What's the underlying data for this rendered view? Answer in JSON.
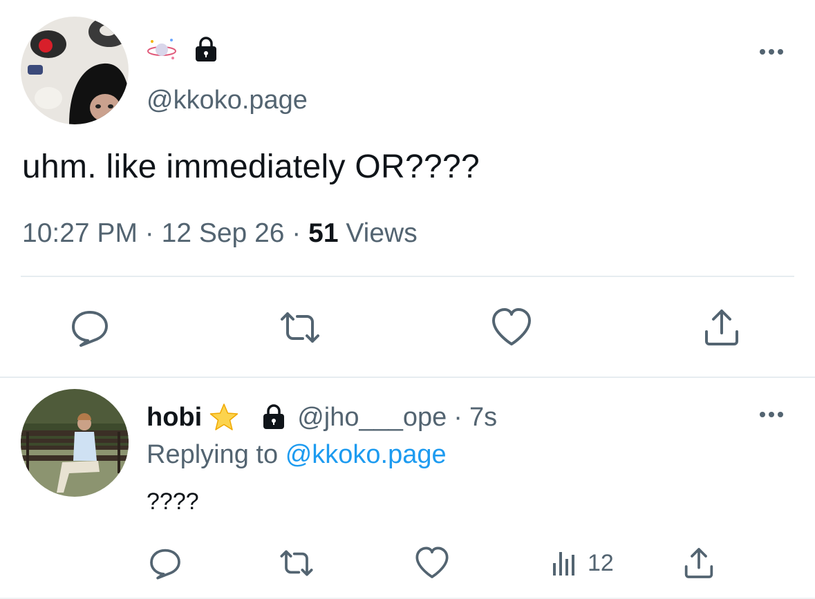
{
  "main_tweet": {
    "handle": "@kkoko.page",
    "text": "uhm. like immediately OR????",
    "time": "10:27 PM",
    "separator": "·",
    "date": "12 Sep 26",
    "views_count": "51",
    "views_label": "Views"
  },
  "reply": {
    "display_name": "hobi",
    "handle": "@jho___ope",
    "separator": "·",
    "time": "7s",
    "replying_prefix": "Replying to",
    "replying_to": "@kkoko.page",
    "text": "????",
    "views_count": "12"
  },
  "colors": {
    "text_primary": "#0f1419",
    "text_secondary": "#536471",
    "link": "#1d9bf0",
    "icon": "#536471"
  },
  "icons": {
    "name_emoji": "planet-emoji-icon",
    "protected": "lock-icon",
    "more": "more-horizontal-icon",
    "reply": "reply-bubble-icon",
    "retweet": "retweet-icon",
    "like": "heart-icon",
    "share": "share-icon",
    "views": "views-bars-icon",
    "verified_star": "star-emoji-icon"
  }
}
